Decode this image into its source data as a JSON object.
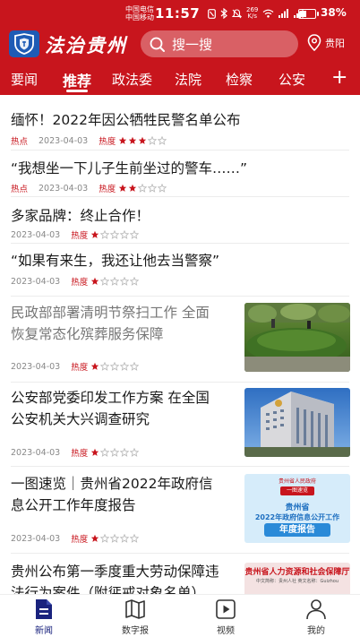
{
  "status_bar": {
    "carrier_1": "中国电信",
    "carrier_2": "中国移动",
    "time": "11:57",
    "net_speed_value": "269",
    "net_speed_unit": "K/s",
    "battery_text": "38%",
    "battery_level": 0.38
  },
  "header": {
    "app_name": "法治贵州",
    "search_placeholder": "搜一搜",
    "location": "贵阳",
    "colors": {
      "header_bg": "#c8151d",
      "logo_bg": "#1e5bb5",
      "accent_red": "#c8151d",
      "nav_active": "#1a237e"
    }
  },
  "tabs": [
    {
      "label": "要闻",
      "active": false
    },
    {
      "label": "推荐",
      "active": true
    },
    {
      "label": "政法委",
      "active": false
    },
    {
      "label": "法院",
      "active": false
    },
    {
      "label": "检察",
      "active": false
    },
    {
      "label": "公安",
      "active": false
    }
  ],
  "tab_add_icon": "plus-icon",
  "feed": [
    {
      "title": "缅怀！2022年因公牺牲民警名单公布",
      "tag": "热点",
      "date": "2023-04-03",
      "hot_label": "热度",
      "hot_level": 3,
      "read": false
    },
    {
      "title": "“我想坐一下儿子生前坐过的警车……”",
      "tag": "热点",
      "date": "2023-04-03",
      "hot_label": "热度",
      "hot_level": 2,
      "read": false
    },
    {
      "title": "多家品牌：终止合作！",
      "tag": "",
      "date": "2023-04-03",
      "hot_label": "热度",
      "hot_level": 1,
      "read": false
    },
    {
      "title": "“如果有来生，我还让他去当警察”",
      "tag": "",
      "date": "2023-04-03",
      "hot_label": "热度",
      "hot_level": 1,
      "read": false
    },
    {
      "title_line_1": "民政部部署清明节祭扫工作 全面",
      "title_line_2": "恢复常态化殡葬服务保障",
      "date": "2023-04-03",
      "hot_label": "热度",
      "hot_level": 1,
      "read": true,
      "thumb": "park-hedge-photo"
    },
    {
      "title_line_1": "公安部党委印发工作方案 在全国",
      "title_line_2": "公安机关大兴调查研究",
      "date": "2023-04-03",
      "hot_label": "热度",
      "hot_level": 1,
      "read": false,
      "thumb": "police-building-photo"
    },
    {
      "title_line_1": "一图速览｜贵州省2022年政府信",
      "title_line_2": "息公开工作年度报告",
      "date": "2023-04-03",
      "hot_label": "热度",
      "hot_level": 1,
      "read": false,
      "thumb": "annual-report-graphic",
      "thumb_text": {
        "org": "贵州省人民政府",
        "badge": "一图速览",
        "line_1": "贵州省",
        "line_2": "2022年政府信息公开工作",
        "line_3": "年度报告"
      }
    },
    {
      "title_line_1": "贵州公布第一季度重大劳动保障违",
      "title_line_2": "法行为案件（附惩戒对象名单）",
      "read": false,
      "thumb": "labor-dept-banner",
      "thumb_text": {
        "line_1": "贵州省人力资源和社会保障厅",
        "line_2": "中文简称：贵州人社 英文名称：Guizhou"
      }
    }
  ],
  "bottom_nav": [
    {
      "label": "新闻",
      "icon": "news-document-icon",
      "active": true
    },
    {
      "label": "数字报",
      "icon": "map-newspaper-icon",
      "active": false
    },
    {
      "label": "视频",
      "icon": "video-play-icon",
      "active": false
    },
    {
      "label": "我的",
      "icon": "user-profile-icon",
      "active": false
    }
  ]
}
